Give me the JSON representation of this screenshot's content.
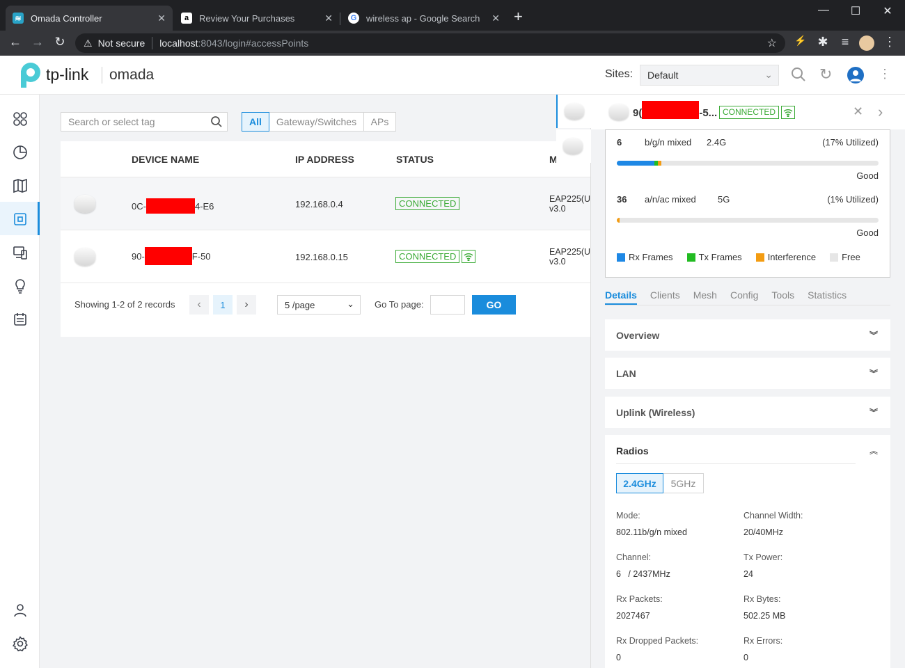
{
  "browser": {
    "tabs": [
      {
        "title": "Omada Controller",
        "favicon": "wifi-icon"
      },
      {
        "title": "Review Your Purchases",
        "favicon": "amazon-icon"
      },
      {
        "title": "wireless ap - Google Search",
        "favicon": "google-icon"
      }
    ],
    "security": "Not secure",
    "url_host": "localhost",
    "url_path": ":8043/login#accessPoints"
  },
  "header": {
    "brand": "tp-link",
    "product": "omada",
    "sites_label": "Sites:",
    "site_value": "Default"
  },
  "toolbar": {
    "search_placeholder": "Search or select tag",
    "filters": [
      "All",
      "Gateway/Switches",
      "APs"
    ]
  },
  "table": {
    "columns": [
      "DEVICE NAME",
      "IP ADDRESS",
      "STATUS",
      "M"
    ],
    "rows": [
      {
        "name_prefix": "0C-",
        "name_suffix": "4-E6",
        "ip": "192.168.0.4",
        "status": "CONNECTED",
        "model": "EAP225(U",
        "version": "v3.0"
      },
      {
        "name_prefix": "90-",
        "name_suffix": "F-50",
        "ip": "192.168.0.15",
        "status": "CONNECTED",
        "model": "EAP225(U",
        "version": "v3.0"
      }
    ]
  },
  "pagination": {
    "showing": "Showing 1-2 of 2 records",
    "page": "1",
    "per_page": "5 /page",
    "goto_label": "Go To page:",
    "go_button": "GO"
  },
  "panel": {
    "device_prefix": "9(",
    "device_suffix": "-5...",
    "status": "CONNECTED",
    "radios": [
      {
        "channel": "6",
        "mode": "b/g/n mixed",
        "band": "2.4G",
        "utilized": "(17% Utilized)",
        "quality": "Good",
        "utilization": 0.17
      },
      {
        "channel": "36",
        "mode": "a/n/ac mixed",
        "band": "5G",
        "utilized": "(1% Utilized)",
        "quality": "Good",
        "utilization": 0.01
      }
    ],
    "legend": [
      {
        "label": "Rx Frames",
        "color": "#1e88e5"
      },
      {
        "label": "Tx Frames",
        "color": "#22bb22"
      },
      {
        "label": "Interference",
        "color": "#f39c12"
      },
      {
        "label": "Free",
        "color": "#e6e6e6"
      }
    ],
    "tabs": [
      "Details",
      "Clients",
      "Mesh",
      "Config",
      "Tools",
      "Statistics"
    ],
    "sections": [
      "Overview",
      "LAN",
      "Uplink (Wireless)"
    ],
    "radios_title": "Radios",
    "band_tabs": [
      "2.4GHz",
      "5GHz"
    ],
    "fields": [
      {
        "label": "Mode:",
        "value": "802.11b/g/n mixed"
      },
      {
        "label": "Channel Width:",
        "value": "20/40MHz"
      },
      {
        "label": "Channel:",
        "value": "6   / 2437MHz"
      },
      {
        "label": "Tx Power:",
        "value": "24"
      },
      {
        "label": "Rx Packets:",
        "value": "2027467"
      },
      {
        "label": "Rx Bytes:",
        "value": "502.25 MB"
      },
      {
        "label": "Rx Dropped Packets:",
        "value": "0"
      },
      {
        "label": "Rx Errors:",
        "value": "0"
      }
    ]
  }
}
